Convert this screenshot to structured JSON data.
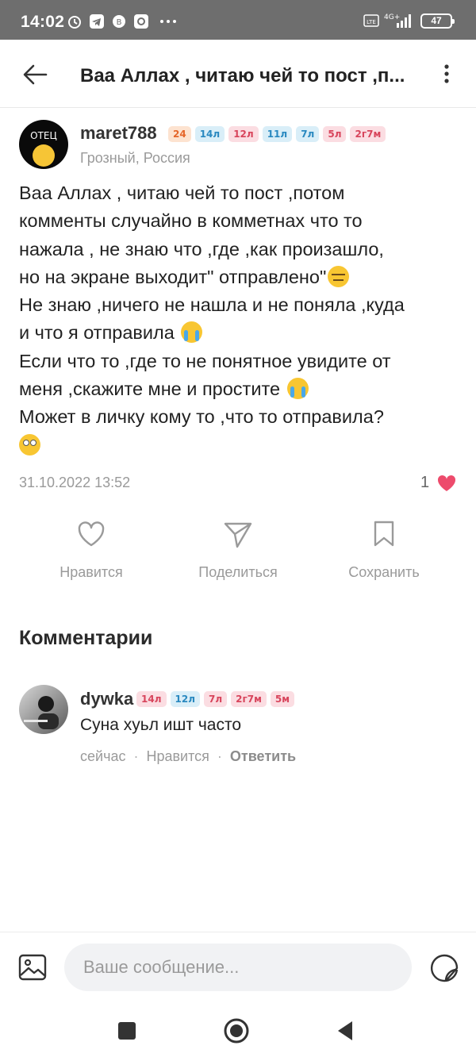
{
  "status_bar": {
    "time": "14:02",
    "battery": "47"
  },
  "header": {
    "title": "Ваа Аллах , читаю чей то пост ,п..."
  },
  "post": {
    "author": {
      "username": "maret788",
      "avatar_text": "ОТЕЦ",
      "location": "Грозный, Россия",
      "badges": [
        {
          "text": "24",
          "color": "orange"
        },
        {
          "text": "14л",
          "color": "blue"
        },
        {
          "text": "12л",
          "color": "pink"
        },
        {
          "text": "11л",
          "color": "blue"
        },
        {
          "text": "7л",
          "color": "blue"
        },
        {
          "text": "5л",
          "color": "pink"
        },
        {
          "text": "2г7м",
          "color": "pink"
        }
      ]
    },
    "text_lines": [
      "Ваа Аллах , читаю чей то пост ,потом",
      "комменты случайно в комметнах что то",
      "нажала , не знаю что ,где ,как произашло,",
      "но на экране выходит\" отправлено\"",
      "Не знаю ,ничего не нашла и не поняла ,куда",
      "и что я отправила ",
      "Если что то ,где то не понятное увидите от",
      "меня ,скажите мне и простите ",
      "Может в личку кому то ,что то отправила?"
    ],
    "date": "31.10.2022 13:52",
    "like_count": "1"
  },
  "actions": {
    "like": "Нравится",
    "share": "Поделиться",
    "save": "Сохранить"
  },
  "comments": {
    "title": "Комментарии",
    "items": [
      {
        "username": "dywka",
        "badges": [
          {
            "text": "14л",
            "color": "pink"
          },
          {
            "text": "12л",
            "color": "blue"
          },
          {
            "text": "7л",
            "color": "pink"
          },
          {
            "text": "2г7м",
            "color": "pink"
          },
          {
            "text": "5м",
            "color": "pink"
          }
        ],
        "text": "Суна хуьл ишт часто",
        "time": "сейчас",
        "like_label": "Нравится",
        "reply_label": "Ответить"
      }
    ]
  },
  "composer": {
    "placeholder": "Ваше сообщение..."
  },
  "colors": {
    "accent_heart": "#ed4b6c",
    "secondary_text": "#9a9a9a",
    "status_bar": "#6e6e6e"
  }
}
